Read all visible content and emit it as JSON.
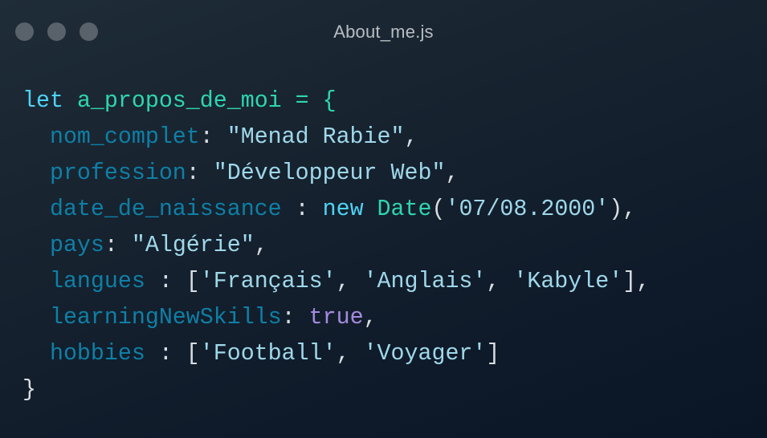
{
  "window": {
    "title": "About_me.js",
    "controls": [
      "close-dot",
      "minimize-dot",
      "maximize-dot"
    ]
  },
  "code": {
    "kw_let": "let",
    "var_name": "a_propos_de_moi",
    "assign": " = {",
    "l1_prop": "nom_complet",
    "l1_sep": ": ",
    "l1_val": "\"Menad Rabie\"",
    "l1_end": ",",
    "l2_prop": "profession",
    "l2_sep": ": ",
    "l2_val": "\"Développeur Web\"",
    "l2_end": ",",
    "l3_prop": "date_de_naissance",
    "l3_sep": " : ",
    "l3_new": "new",
    "l3_fn": "Date",
    "l3_open": "(",
    "l3_val": "'07/08.2000'",
    "l3_end": "),",
    "l4_prop": "pays",
    "l4_sep": ": ",
    "l4_val": "\"Algérie\"",
    "l4_end": ",",
    "l5_prop": "langues",
    "l5_sep": " : [",
    "l5_v1": "'Français'",
    "l5_c1": ", ",
    "l5_v2": "'Anglais'",
    "l5_c2": ", ",
    "l5_v3": "'Kabyle'",
    "l5_end": "],",
    "l6_prop": "learningNewSkills",
    "l6_sep": ": ",
    "l6_val": "true",
    "l6_end": ",",
    "l7_prop": "hobbies",
    "l7_sep": " : [",
    "l7_v1": "'Football'",
    "l7_c1": ", ",
    "l7_v2": "'Voyager'",
    "l7_end": "]",
    "close": "}"
  },
  "colors": {
    "keyword": "#4ed3f5",
    "variable": "#2fd5b0",
    "property": "#0f7fa6",
    "string": "#9fd8ea",
    "boolean": "#a58be0",
    "punctuation": "#d8dde2",
    "window_dot": "#59616a"
  }
}
